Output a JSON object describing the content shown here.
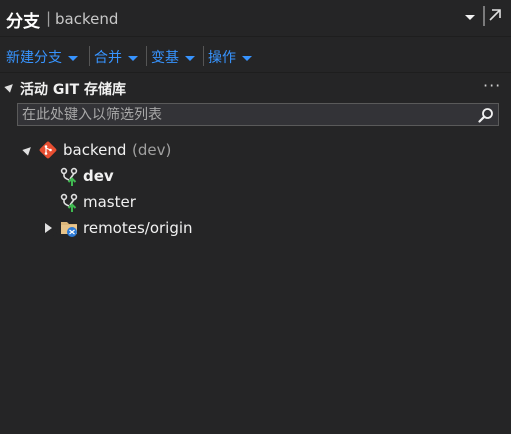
{
  "header": {
    "title": "分支",
    "separator": "|",
    "repo": "backend",
    "dropdown_icon": "caret-down-icon",
    "popout_icon": "popout-arrow-icon"
  },
  "toolbar": {
    "items": [
      {
        "label": "新建分支"
      },
      {
        "label": "合并"
      },
      {
        "label": "变基"
      },
      {
        "label": "操作"
      }
    ]
  },
  "section": {
    "title": "活动 GIT 存储库",
    "more": "···"
  },
  "search": {
    "placeholder": "在此处键入以筛选列表",
    "value": ""
  },
  "tree": {
    "repo": {
      "name": "backend",
      "current": "(dev)",
      "icon": "git-repo-icon"
    },
    "branches": [
      {
        "name": "dev",
        "active": true,
        "icon": "branch-icon"
      },
      {
        "name": "master",
        "active": false,
        "icon": "branch-icon"
      }
    ],
    "remotes": {
      "name": "remotes/origin",
      "icon": "remote-folder-icon"
    }
  },
  "colors": {
    "background": "#252526",
    "accent": "#3794ff",
    "git": "#e84e31",
    "branch_arrow": "#3fb950"
  }
}
